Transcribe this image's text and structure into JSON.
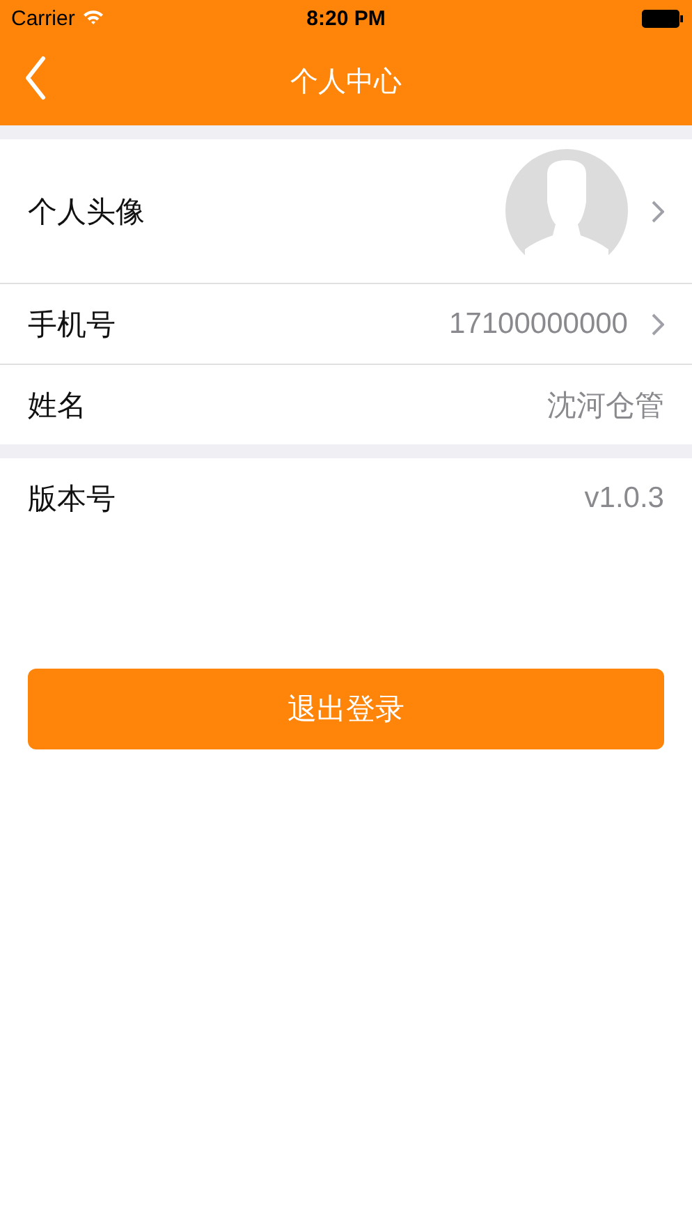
{
  "status_bar": {
    "carrier": "Carrier",
    "time": "8:20 PM"
  },
  "nav": {
    "title": "个人中心"
  },
  "groups": [
    {
      "rows": [
        {
          "kind": "avatar",
          "label": "个人头像",
          "chevron": true
        },
        {
          "kind": "text",
          "label": "手机号",
          "value": "17100000000",
          "chevron": true
        },
        {
          "kind": "text",
          "label": "姓名",
          "value": "沈河仓管",
          "chevron": false
        }
      ]
    },
    {
      "rows": [
        {
          "kind": "text",
          "label": "版本号",
          "value": "v1.0.3",
          "chevron": false
        }
      ]
    }
  ],
  "logout_button": "退出登录"
}
